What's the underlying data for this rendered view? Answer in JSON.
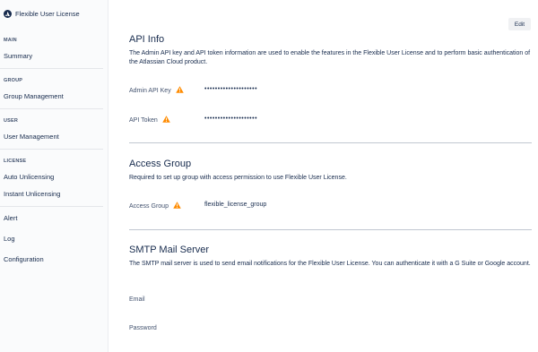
{
  "sidebar": {
    "app_name": "Flexible User License",
    "sections": [
      {
        "title": "MAIN",
        "items": [
          "Summary"
        ]
      },
      {
        "title": "GROUP",
        "items": [
          "Group Management"
        ]
      },
      {
        "title": "USER",
        "items": [
          "User Management"
        ]
      },
      {
        "title": "LICENSE",
        "items": [
          "Auto Unlicensing",
          "Instant Unlicensing"
        ]
      }
    ],
    "extra_items": [
      "Alert",
      "Log",
      "Configuration"
    ]
  },
  "main": {
    "edit_label": "Edit",
    "api_info": {
      "title": "API Info",
      "description": "The Admin API key and API token information are used to enable the features in the Flexible User License and to perform basic authentication of the Atlassian Cloud product.",
      "admin_key_label": "Admin API Key",
      "admin_key_value": "••••••••••••••••••••",
      "token_label": "API Token",
      "token_value": "••••••••••••••••••••"
    },
    "access_group": {
      "title": "Access Group",
      "description": "Required to set up group with access permission to use Flexible User License.",
      "label": "Access Group",
      "value": "flexible_license_group"
    },
    "smtp": {
      "title": "SMTP Mail Server",
      "description": "The SMTP mail server is used to send email notifications for the Flexible User License. You can authenticate it with a G Suite or Google account.",
      "email_label": "Email",
      "password_label": "Password"
    }
  },
  "colors": {
    "warning": "#ff8b00",
    "text": "#172b4d",
    "sidebar_bg": "#fafbfc"
  },
  "icons": {
    "brand": "atlassian-logo-icon",
    "warning": "warning-triangle-icon"
  }
}
